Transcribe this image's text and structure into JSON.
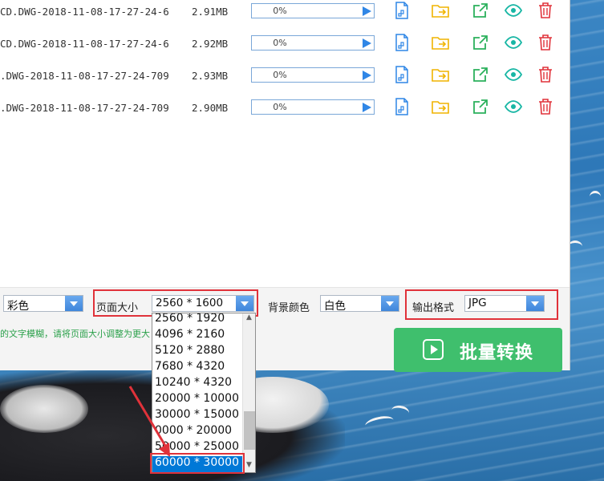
{
  "files": [
    {
      "name": "CD.DWG-2018-11-08-17-27-24-6",
      "size": "2.91MB",
      "progress": "0%"
    },
    {
      "name": "CD.DWG-2018-11-08-17-27-24-6",
      "size": "2.92MB",
      "progress": "0%"
    },
    {
      "name": ".DWG-2018-11-08-17-27-24-709",
      "size": "2.93MB",
      "progress": "0%"
    },
    {
      "name": ".DWG-2018-11-08-17-27-24-709",
      "size": "2.90MB",
      "progress": "0%"
    }
  ],
  "options": {
    "color_mode_value": "彩色",
    "page_size_label": "页面大小",
    "page_size_value": "2560 * 1600",
    "bg_color_label": "背景颜色",
    "bg_color_value": "白色",
    "output_format_label": "输出格式",
    "output_format_value": "JPG"
  },
  "hint": "的文字模糊，请将页面大小调整为更大",
  "convert_button": "批量转换",
  "page_size_options": [
    "2560 * 1920",
    "4096 * 2160",
    "5120 * 2880",
    "7680 * 4320",
    "10240 * 4320",
    "20000 * 10000",
    "30000 * 15000",
    "0000 * 20000",
    "50000 * 25000",
    "60000 * 30000"
  ],
  "selected_page_size": "60000 * 30000",
  "icons": [
    "file-icon",
    "folder-export-icon",
    "open-external-icon",
    "eye-icon",
    "trash-icon"
  ],
  "colors": {
    "accent": "#3fbf6d",
    "blue": "#2f86e6",
    "red": "#e0323a",
    "yellow": "#f0b400",
    "teal": "#17b6a4"
  }
}
